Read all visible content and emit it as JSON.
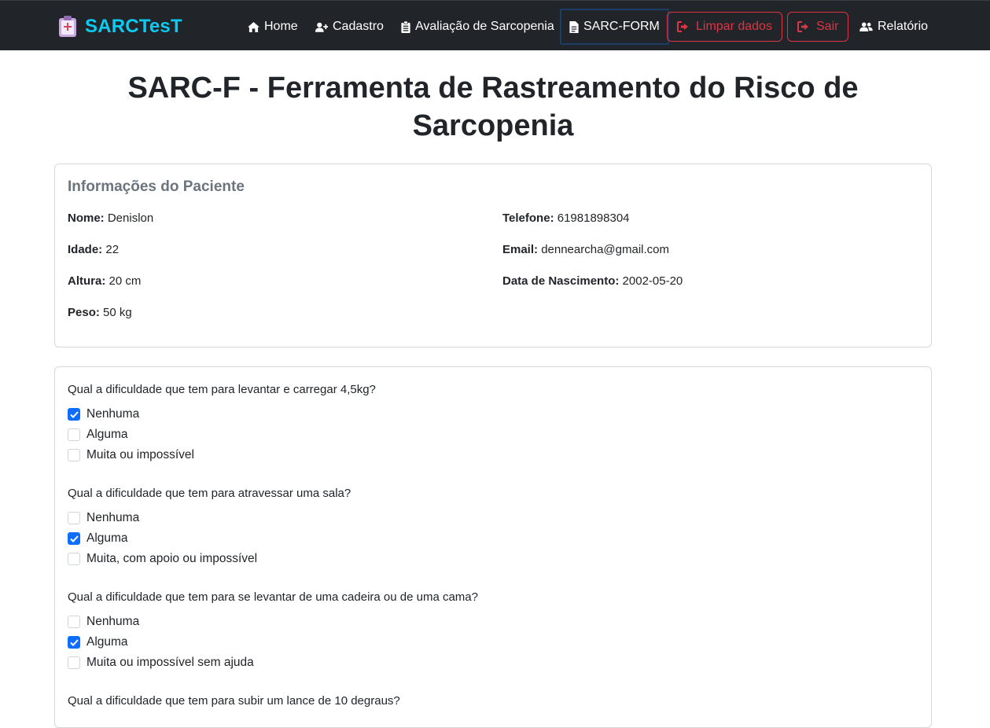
{
  "brand": {
    "name": "SARCTesT"
  },
  "nav": {
    "home": "Home",
    "cadastro": "Cadastro",
    "avaliacao": "Avaliação de Sarcopenia",
    "sarc_form": "SARC-FORM",
    "limpar": "Limpar dados",
    "sair": "Sair",
    "relatorio": "Relatório"
  },
  "colors": {
    "navbar": "#212529",
    "brand": "#0dcaf0",
    "danger": "#dc3545",
    "primary": "#0d6efd"
  },
  "page_title": "SARC-F - Ferramenta de Rastreamento do Risco de Sarcopenia",
  "patient": {
    "heading": "Informações do Paciente",
    "fields": [
      {
        "label": "Nome:",
        "value": "Denislon"
      },
      {
        "label": "Idade:",
        "value": "22"
      },
      {
        "label": "Altura:",
        "value": "20 cm"
      },
      {
        "label": "Peso:",
        "value": "50 kg"
      },
      {
        "label": "Telefone:",
        "value": "61981898304"
      },
      {
        "label": "Email:",
        "value": "dennearcha@gmail.com"
      },
      {
        "label": "Data de Nascimento:",
        "value": "2002-05-20"
      }
    ]
  },
  "questions": [
    {
      "text": "Qual a dificuldade que tem para levantar e carregar 4,5kg?",
      "options": [
        {
          "label": "Nenhuma",
          "checked": true
        },
        {
          "label": "Alguma",
          "checked": false
        },
        {
          "label": "Muita ou impossível",
          "checked": false
        }
      ]
    },
    {
      "text": "Qual a dificuldade que tem para atravessar uma sala?",
      "options": [
        {
          "label": "Nenhuma",
          "checked": false
        },
        {
          "label": "Alguma",
          "checked": true
        },
        {
          "label": "Muita, com apoio ou impossível",
          "checked": false
        }
      ]
    },
    {
      "text": "Qual a dificuldade que tem para se levantar de uma cadeira ou de uma cama?",
      "options": [
        {
          "label": "Nenhuma",
          "checked": false
        },
        {
          "label": "Alguma",
          "checked": true
        },
        {
          "label": "Muita ou impossível sem ajuda",
          "checked": false
        }
      ]
    },
    {
      "text": "Qual a dificuldade que tem para subir um lance de 10 degraus?"
    }
  ]
}
